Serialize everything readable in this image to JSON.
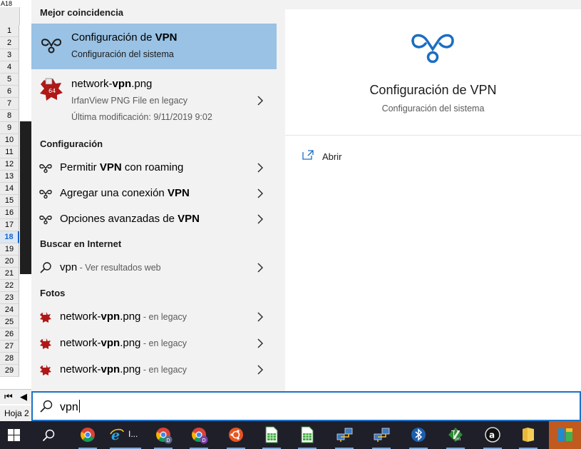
{
  "spreadsheet": {
    "name_box": "A18",
    "rows": [
      "1",
      "2",
      "3",
      "4",
      "5",
      "6",
      "7",
      "8",
      "9",
      "10",
      "11",
      "12",
      "13",
      "14",
      "15",
      "16",
      "17",
      "18",
      "19",
      "20",
      "21",
      "22",
      "23",
      "24",
      "25",
      "26",
      "27",
      "28",
      "29"
    ],
    "active_row": "18",
    "sheet_tab": "Hoja 2"
  },
  "search": {
    "query": "vpn",
    "best_match": {
      "header": "Mejor coincidencia",
      "title_pre": "Configuración de ",
      "title_bold": "VPN",
      "subtitle": "Configuración del sistema"
    },
    "file_result": {
      "name_pre": "network-",
      "name_bold": "vpn",
      "name_post": ".png",
      "type": "IrfanView PNG File en legacy",
      "modified": "Última modificación: 9/11/2019 9:02"
    },
    "settings": {
      "header": "Configuración",
      "items": [
        {
          "pre": "Permitir ",
          "bold": "VPN",
          "post": " con roaming"
        },
        {
          "pre": "Agregar una conexión ",
          "bold": "VPN",
          "post": ""
        },
        {
          "pre": "Opciones avanzadas de ",
          "bold": "VPN",
          "post": ""
        }
      ]
    },
    "web": {
      "header": "Buscar en Internet",
      "query": "vpn",
      "suffix": " - Ver resultados web"
    },
    "photos": {
      "header": "Fotos",
      "items": [
        {
          "pre": "network-",
          "bold": "vpn",
          "post": ".png",
          "suffix": " - en legacy"
        },
        {
          "pre": "network-",
          "bold": "vpn",
          "post": ".png",
          "suffix": " - en legacy"
        },
        {
          "pre": "network-",
          "bold": "vpn",
          "post": ".png",
          "suffix": " - en legacy"
        }
      ]
    }
  },
  "preview": {
    "title": "Configuración de VPN",
    "subtitle": "Configuración del sistema",
    "open_action": "Abrir"
  },
  "taskbar": {
    "items": [
      "start",
      "search",
      "chrome",
      "internet-explorer",
      "chrome-profile-d",
      "chrome-profile-d2",
      "ubuntu",
      "libreoffice-calc",
      "libreoffice-calc-2",
      "network-1",
      "network-2",
      "bluetooth",
      "vim",
      "app-a",
      "folder",
      "store"
    ],
    "ie_label": "I..."
  },
  "colors": {
    "accent": "#1a73c8",
    "selection": "#99c2e5",
    "vpn_icon": "#1b6ec2",
    "taskbar": "#1f1f2a"
  }
}
